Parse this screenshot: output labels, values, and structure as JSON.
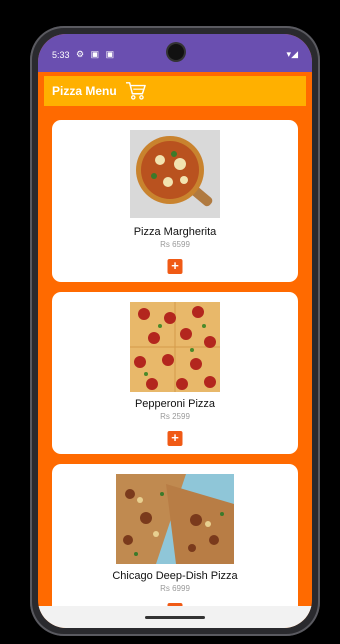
{
  "status": {
    "time": "5:33",
    "icons": "⚙ ▣ ▣",
    "right": "▾◢"
  },
  "appbar": {
    "title": "Pizza Menu"
  },
  "items": [
    {
      "name": "Pizza Margherita",
      "price": "Rs 6599",
      "add": "+"
    },
    {
      "name": "Pepperoni Pizza",
      "price": "Rs 2599",
      "add": "+"
    },
    {
      "name": "Chicago Deep-Dish Pizza",
      "price": "Rs 6999",
      "add": "+"
    }
  ],
  "colors": {
    "accent": "#ff6a00",
    "appbar": "#ffb000",
    "statusbar": "#6a4fb0",
    "button": "#f05a15"
  }
}
